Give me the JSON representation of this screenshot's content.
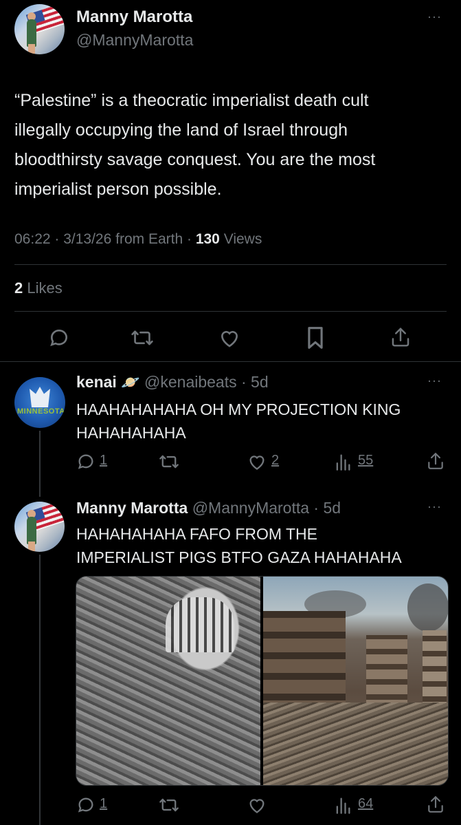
{
  "main_tweet": {
    "display_name": "Manny Marotta",
    "handle": "@MannyMarotta",
    "text_lines": [
      "“Palestine” is a theocratic imperialist death cult",
      "illegally occupying the land of Israel through",
      "bloodthirsty savage conquest. You are the most",
      "imperialist person possible."
    ],
    "meta_prefix": "06:22 · 3/13/26 from Earth · ",
    "views_count": "130",
    "views_label": " Views",
    "likes_count": "2",
    "likes_label": " Likes",
    "more_glyph": "···"
  },
  "reply_1": {
    "display_name": "kenai",
    "emoji": "🪐",
    "handle_time": "@kenaibeats · 5d",
    "text_lines": [
      "HAAHAHAHAHA OH MY PROJECTION KING",
      "HAHAHAHAHA"
    ],
    "replies": "1",
    "likes": "2",
    "views": "55",
    "avatar_text": "MINNESOTA"
  },
  "reply_2": {
    "display_name": "Manny Marotta",
    "handle_time": "@MannyMarotta · 5d",
    "text_lines": [
      "HAHAHAHAHA FAFO FROM THE",
      "IMPERIALIST PIGS BTFO GAZA HAHAHAHA"
    ],
    "replies": "1",
    "views": "64"
  },
  "icons": [
    "reply-icon",
    "retweet-icon",
    "like-icon",
    "bookmark-icon",
    "share-icon",
    "views-icon",
    "more-icon"
  ]
}
